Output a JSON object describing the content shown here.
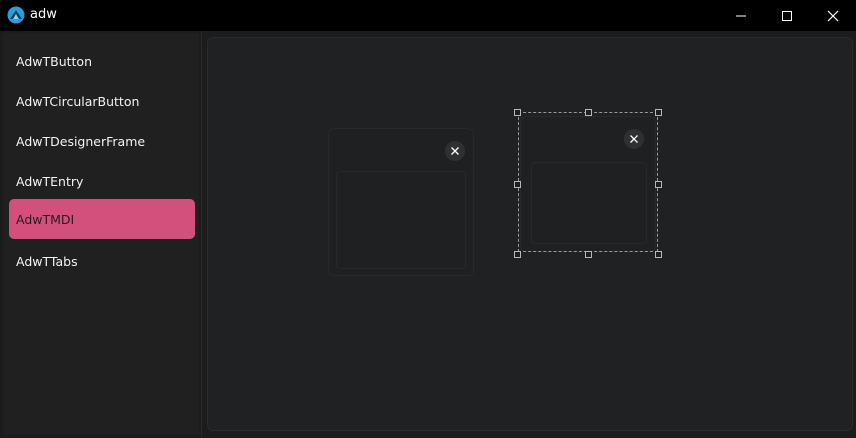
{
  "window": {
    "title": "adw",
    "icon": "app-logo-icon",
    "controls": [
      "minimize-icon",
      "maximize-icon",
      "close-icon"
    ]
  },
  "sidebar": {
    "items": [
      {
        "label": "AdwTButton",
        "active": false
      },
      {
        "label": "AdwTCircularButton",
        "active": false
      },
      {
        "label": "AdwTDesignerFrame",
        "active": false
      },
      {
        "label": "AdwTEntry",
        "active": false
      },
      {
        "label": "AdwTMDI",
        "active": true
      },
      {
        "label": "AdwTTabs",
        "active": false
      }
    ]
  },
  "mdi": {
    "windows": [
      {
        "name": "mdi-window-1",
        "close_icon": "close-icon",
        "selected": false
      },
      {
        "name": "mdi-window-2",
        "close_icon": "close-icon",
        "selected": true
      }
    ]
  },
  "colors": {
    "accent": "#d3507d",
    "titlebar": "#000000",
    "background": "#1c1c1c",
    "panel": "#202122"
  }
}
